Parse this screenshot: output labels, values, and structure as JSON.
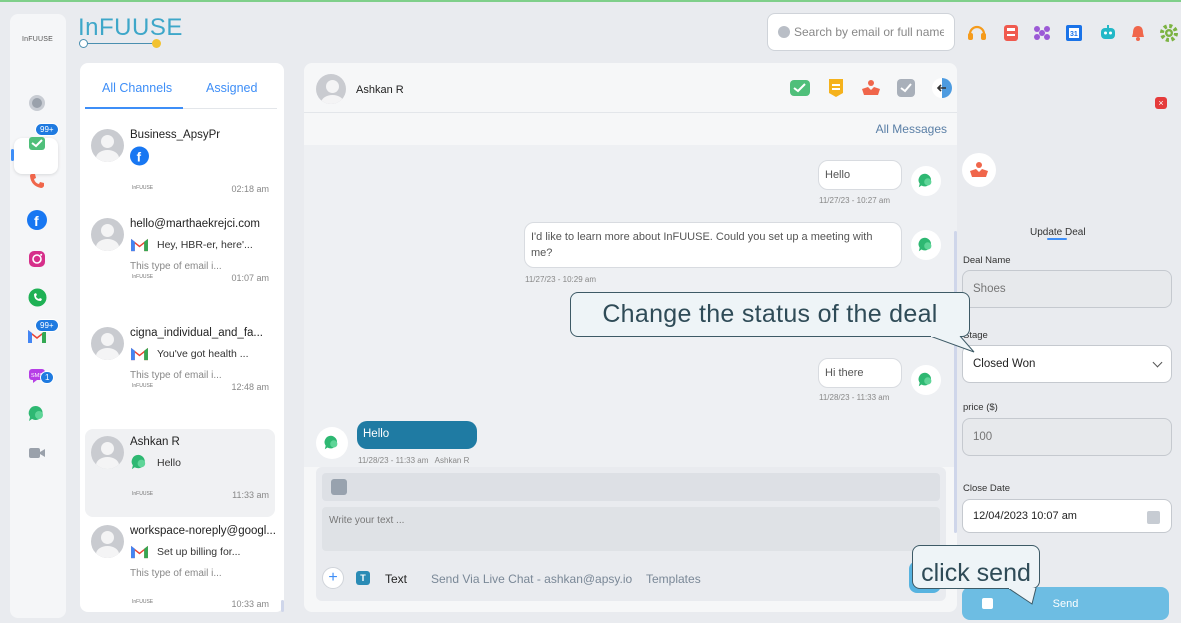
{
  "brand": {
    "name": "InFUUSE",
    "rail_logo": "InFUUSE"
  },
  "rail": {
    "items": [
      {
        "icon": "dashboard-icon"
      },
      {
        "icon": "inbox-icon",
        "badge": "99+"
      },
      {
        "icon": "phone-icon"
      },
      {
        "icon": "facebook-icon"
      },
      {
        "icon": "instagram-icon"
      },
      {
        "icon": "whatsapp-icon"
      },
      {
        "icon": "gmail-icon",
        "badge": "99+"
      },
      {
        "icon": "sms-icon",
        "badge": "1"
      },
      {
        "icon": "livechat-icon"
      },
      {
        "icon": "video-icon"
      }
    ]
  },
  "search": {
    "placeholder": "Search by email or full name"
  },
  "toolbar_icons": [
    "headset-icon",
    "save-icon",
    "team-icon",
    "calendar-icon",
    "robot-icon",
    "bell-icon",
    "settings-icon"
  ],
  "channels": {
    "tabs": [
      "All Channels",
      "Assigned"
    ],
    "items": [
      {
        "name": "Business_ApsyPr",
        "preview": "",
        "channel": "facebook-icon",
        "sub": "",
        "logo": "InFUUSE",
        "time": "02:18 am"
      },
      {
        "name": "hello@marthaekrejci.com",
        "preview": "Hey, HBR-er, here'...",
        "channel": "gmail-icon",
        "sub": "This type of email i...",
        "logo": "InFUUSE",
        "time": "01:07 am"
      },
      {
        "name": "cigna_individual_and_fa...",
        "preview": "You've got health ...",
        "channel": "gmail-icon",
        "sub": "This type of email i...",
        "logo": "InFUUSE",
        "time": "12:48 am"
      },
      {
        "name": "Ashkan R",
        "preview": "Hello",
        "channel": "livechat-icon",
        "sub": "",
        "logo": "InFUUSE",
        "time": "11:33 am"
      },
      {
        "name": "workspace-noreply@googl...",
        "preview": "Set up billing for...",
        "channel": "gmail-icon",
        "sub": "This type of email i...",
        "logo": "InFUUSE",
        "time": "10:33 am"
      }
    ]
  },
  "chat": {
    "contact": "Ashkan R",
    "filter": "All Messages",
    "messages": [
      {
        "text": "Hello",
        "time": "11/27/23 - 10:27 am"
      },
      {
        "text": "I'd like to learn more about InFUUSE. Could you set up a meeting with me?",
        "time": "11/27/23 - 10:29 am"
      },
      {
        "text": "Hi there",
        "time": "11/28/23 - 11:33 am"
      },
      {
        "text": "Hello",
        "time": "11/28/23 - 11:33 am",
        "author": "Ashkan R"
      }
    ],
    "composer": {
      "placeholder": "Write your text ...",
      "mode": "Text",
      "via": "Send Via Live Chat - ashkan@apsy.io",
      "templates": "Templates"
    }
  },
  "deal": {
    "title": "Update Deal",
    "name_label": "Deal Name",
    "name_placeholder": "Shoes",
    "stage_label": "Stage",
    "stage_value": "Closed Won",
    "price_label": "price ($)",
    "price_placeholder": "100",
    "close_label": "Close Date",
    "close_value": "12/04/2023 10:07 am",
    "send_label": "Send"
  },
  "callouts": {
    "status": "Change the status of the deal",
    "send": "click send"
  }
}
